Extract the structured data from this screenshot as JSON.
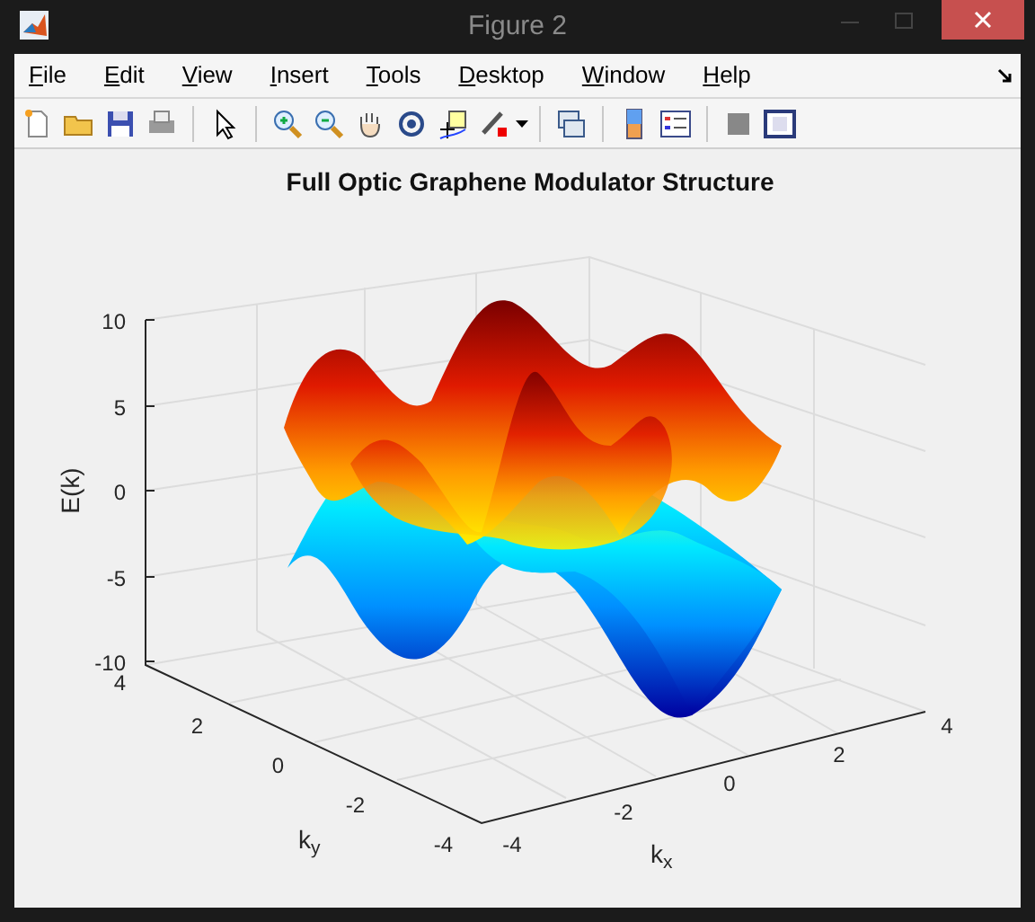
{
  "window": {
    "title": "Figure 2"
  },
  "menu": [
    "File",
    "Edit",
    "View",
    "Insert",
    "Tools",
    "Desktop",
    "Window",
    "Help"
  ],
  "plot": {
    "title": "Full Optic Graphene Modulator Structure",
    "zlabel": "E(k)",
    "xlabel": "k$_{x}$",
    "ylabel": "k$_{y}$",
    "zticks": [
      "10",
      "5",
      "0",
      "-5",
      "-10"
    ],
    "yticks": [
      "4",
      "2",
      "0",
      "-2",
      "-4"
    ],
    "xticks": [
      "-4",
      "-2",
      "0",
      "2",
      "4"
    ]
  }
}
